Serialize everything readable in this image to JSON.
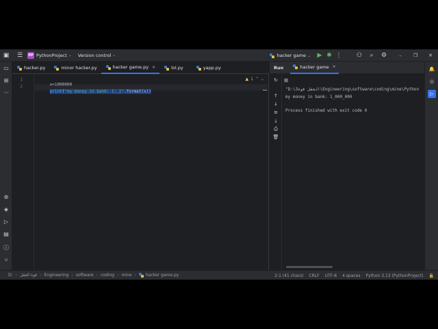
{
  "titlebar": {
    "project_badge": "PP",
    "project_name": "PythonProject",
    "version_control": "Version control",
    "run_config": "hacker game"
  },
  "editor": {
    "tabs": [
      {
        "label": "hacker.py"
      },
      {
        "label": "minor hacker.py"
      },
      {
        "label": "hacker game.py",
        "active": true
      },
      {
        "label": "lol.py"
      },
      {
        "label": "yapp.py"
      }
    ],
    "line_numbers": [
      "1",
      "2"
    ],
    "code": {
      "line1": "x=1000000",
      "line2_fn": "print",
      "line2_paren": "(",
      "line2_str": "\"my money in bank: {:_}\"",
      "line2_rest": ".format(x)",
      "line2_close": ")"
    },
    "warning_count": "1"
  },
  "run": {
    "title": "Run",
    "tab_label": "hacker game",
    "output": [
      "\"D:\\3العقل قوة\\Engineering\\software\\coding\\mine\\Python",
      "my money in bank: 1_000_000",
      "",
      "Process finished with exit code 0"
    ]
  },
  "statusbar": {
    "crumbs": [
      "D:",
      "قوة العقل",
      "Engineering",
      "software",
      "coding",
      "mine",
      "hacker game.py"
    ],
    "position": "2:1 (41 chars)",
    "line_sep": "CRLF",
    "encoding": "UTF-8",
    "indent": "4 spaces",
    "interpreter": "Python 3.13 (PythonProject)"
  },
  "colors": {
    "accent": "#3574f0",
    "selection": "#214283",
    "string": "#6aab73",
    "function": "#56a8f5",
    "number": "#2aacb8"
  }
}
